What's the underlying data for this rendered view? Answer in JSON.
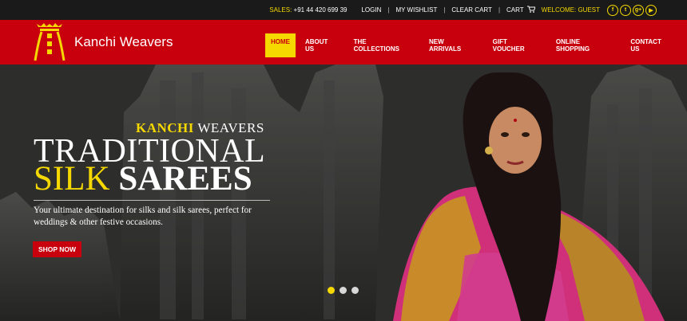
{
  "topbar": {
    "sales_label": "SALES:",
    "sales_number": "+91 44 420 699 39",
    "login": "LOGIN",
    "wishlist": "MY WISHLIST",
    "clear_cart": "CLEAR CART",
    "cart": "CART",
    "cart_icon": "cart-icon",
    "welcome": "WELCOME: GUEST",
    "socials": [
      {
        "icon": "facebook-icon",
        "glyph": "f"
      },
      {
        "icon": "twitter-icon",
        "glyph": "t"
      },
      {
        "icon": "google-plus-icon",
        "glyph": "g+"
      },
      {
        "icon": "youtube-icon",
        "glyph": "▶"
      }
    ]
  },
  "header": {
    "brand": "Kanchi Weavers",
    "nav": [
      {
        "label": "HOME",
        "active": true
      },
      {
        "label": "ABOUT US"
      },
      {
        "label": "THE COLLECTIONS"
      },
      {
        "label": "NEW ARRIVALS"
      },
      {
        "label": "GIFT VOUCHER"
      },
      {
        "label": "ONLINE SHOPPING"
      },
      {
        "label": "CONTACT US"
      }
    ]
  },
  "hero": {
    "kicker_1": "KANCHI",
    "kicker_2": "WEAVERS",
    "title_1": "TRADITIONAL",
    "title_2a": "SILK",
    "title_2b": "SAREES",
    "description": "Your ultimate destination for silks and silk sarees, perfect for weddings & other festive occasions.",
    "cta": "SHOP NOW",
    "slides": 3,
    "active_slide": 1
  },
  "colors": {
    "brand_red": "#c8000e",
    "accent_yellow": "#f5d800",
    "topbar_bg": "#1a1a1a"
  }
}
